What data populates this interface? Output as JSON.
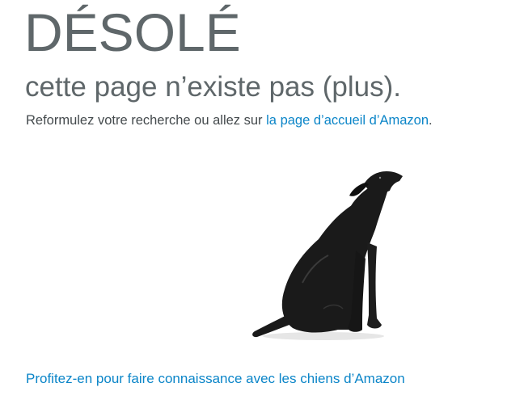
{
  "error": {
    "headline": "DÉSOLÉ",
    "subheadline": "cette page n’existe pas (plus).",
    "message_prefix": "Reformulez votre recherche ou allez sur ",
    "home_link_label": "la page d’accueil d’Amazon",
    "message_suffix": "."
  },
  "image": {
    "subject": "black-dog-icon",
    "dog_color": "#1a1a1a"
  },
  "footer": {
    "dogs_link_label": "Profitez-en pour faire connaissance avec les chiens d’Amazon"
  },
  "colors": {
    "heading": "#5f676a",
    "link": "#0b85c8",
    "body_text": "#444a4d"
  }
}
